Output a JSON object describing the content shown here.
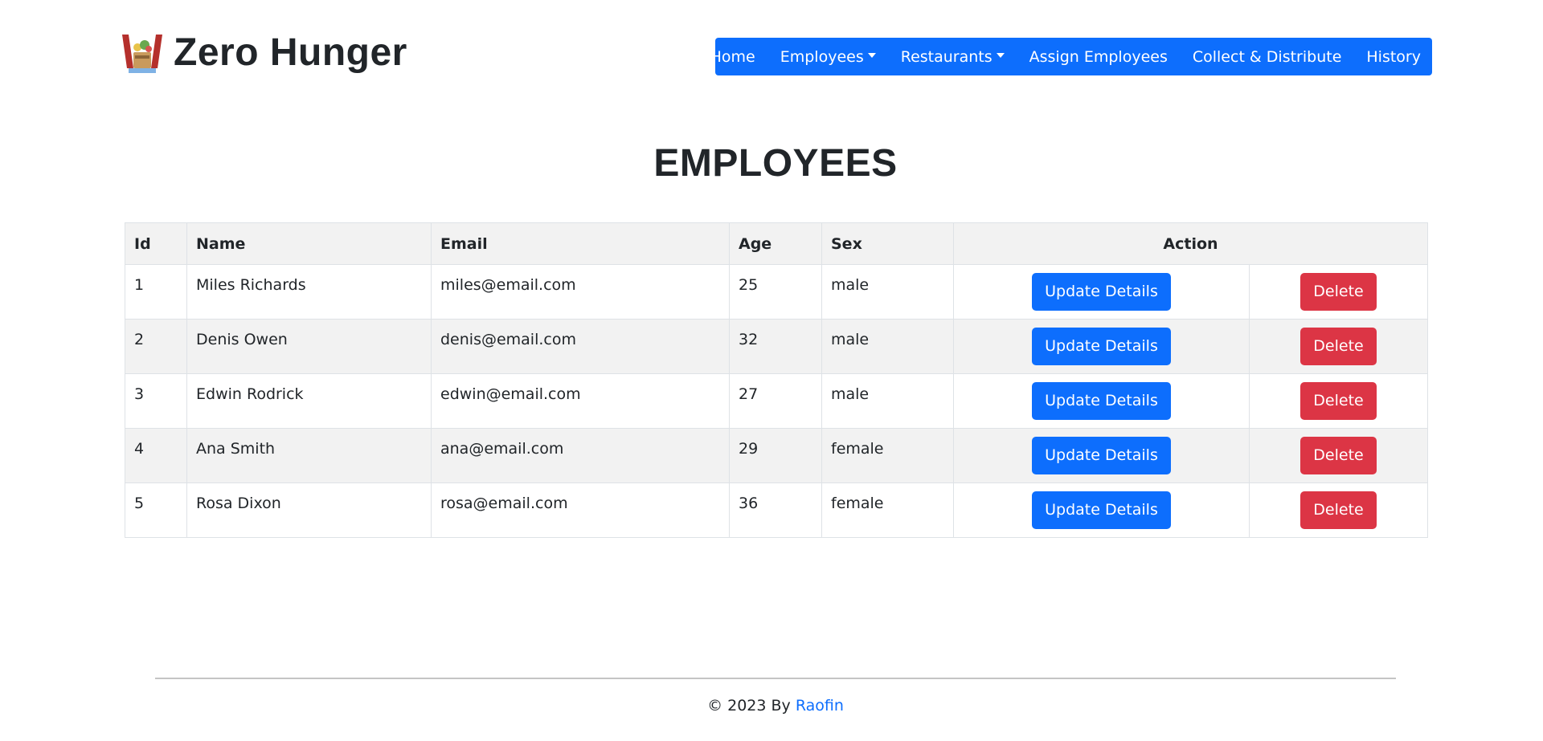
{
  "brand": {
    "title": "Zero Hunger",
    "logo_icon": "food-basket-icon"
  },
  "nav": {
    "items": [
      {
        "label": "Home",
        "dropdown": false
      },
      {
        "label": "Employees",
        "dropdown": true
      },
      {
        "label": "Restaurants",
        "dropdown": true
      },
      {
        "label": "Assign Employees",
        "dropdown": false
      },
      {
        "label": "Collect & Distribute",
        "dropdown": false
      },
      {
        "label": "History",
        "dropdown": false
      }
    ]
  },
  "page": {
    "title": "EMPLOYEES"
  },
  "table": {
    "headers": {
      "id": "Id",
      "name": "Name",
      "email": "Email",
      "age": "Age",
      "sex": "Sex",
      "action": "Action"
    },
    "update_label": "Update Details",
    "delete_label": "Delete",
    "rows": [
      {
        "id": "1",
        "name": "Miles Richards",
        "email": "miles@email.com",
        "age": "25",
        "sex": "male"
      },
      {
        "id": "2",
        "name": "Denis Owen",
        "email": "denis@email.com",
        "age": "32",
        "sex": "male"
      },
      {
        "id": "3",
        "name": "Edwin Rodrick",
        "email": "edwin@email.com",
        "age": "27",
        "sex": "male"
      },
      {
        "id": "4",
        "name": "Ana Smith",
        "email": "ana@email.com",
        "age": "29",
        "sex": "female"
      },
      {
        "id": "5",
        "name": "Rosa Dixon",
        "email": "rosa@email.com",
        "age": "36",
        "sex": "female"
      }
    ]
  },
  "footer": {
    "text": "© 2023 By",
    "link": "Raofin"
  },
  "colors": {
    "primary": "#0d6efd",
    "danger": "#dc3545",
    "stripe": "#f2f2f2"
  }
}
